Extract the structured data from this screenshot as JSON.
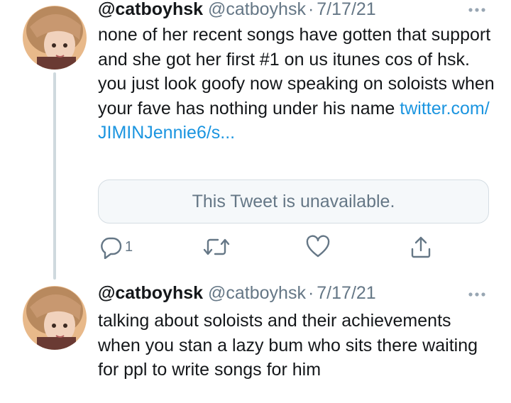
{
  "tweets": [
    {
      "username": "@catboyhsk",
      "handle": "@catboyhsk",
      "date": "7/17/21",
      "text": "none of her recent songs have gotten that support and she got her first #1 on us itunes cos of hsk. you just look goofy now speaking on soloists when your fave has nothing under his name",
      "link_line1": "twitter.com/",
      "link_line2": "JIMINJennie6/s...",
      "quoted_tweet": "This Tweet is unavailable.",
      "reply_count": "1"
    },
    {
      "username": "@catboyhsk",
      "handle": "@catboyhsk",
      "date": "7/17/21",
      "text": "talking about soloists and their achievements when you stan a lazy bum who sits there waiting for ppl to write songs for him"
    }
  ],
  "separator": "·",
  "icons": {
    "reply": "reply-icon",
    "retweet": "retweet-icon",
    "like": "like-icon",
    "share": "share-icon",
    "more": "more-icon"
  },
  "colors": {
    "link": "#1b95e0",
    "muted": "#657786",
    "card_bg": "#f5f8fa",
    "thread_line": "#cfd9de"
  }
}
